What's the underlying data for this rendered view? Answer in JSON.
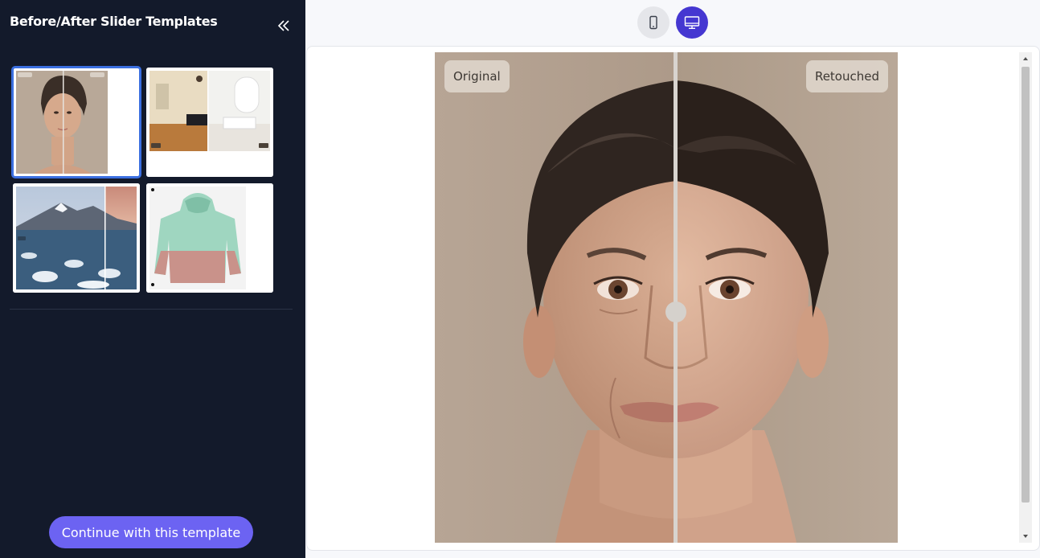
{
  "sidebar": {
    "title": "Before/After Slider Templates",
    "collapse_icon": "double-chevron-left-icon",
    "templates": [
      {
        "name": "portrait-retouch",
        "label_left": "Original",
        "label_right": "Retouched",
        "selected": true
      },
      {
        "name": "interior-room",
        "label_left": "Before",
        "label_right": "After",
        "selected": false
      },
      {
        "name": "frozen-lake",
        "label_left": "Before",
        "selected": false
      },
      {
        "name": "hoodie-color",
        "selected": false
      }
    ],
    "continue_label": "Continue with this template"
  },
  "toolbar": {
    "mobile_icon": "mobile-phone-icon",
    "desktop_icon": "desktop-monitor-icon",
    "active_view": "desktop"
  },
  "preview": {
    "label_left": "Original",
    "label_right": "Retouched",
    "slider_position": 0.52
  },
  "colors": {
    "sidebar_bg": "#131a2b",
    "accent": "#6c63f2",
    "active_toggle": "#4537d1",
    "selected_outline": "#3b6fe0"
  }
}
